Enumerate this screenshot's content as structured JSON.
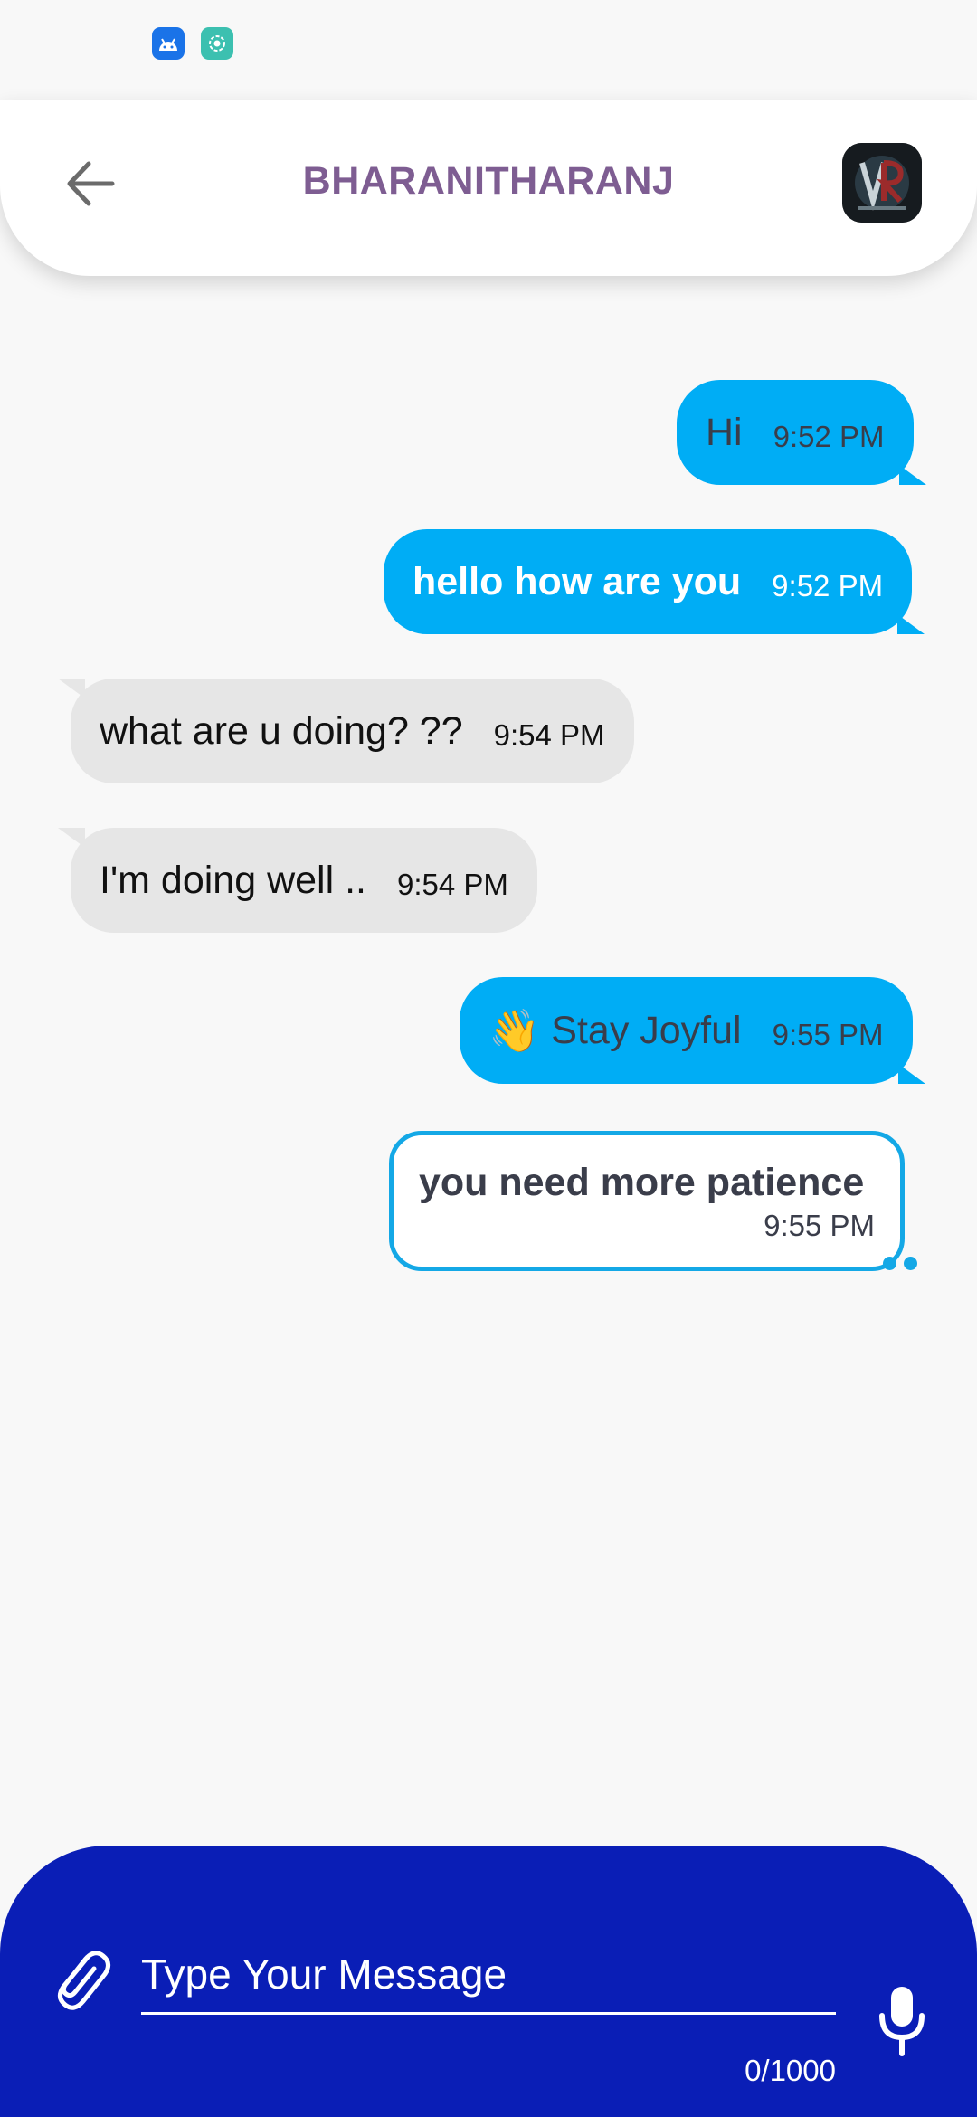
{
  "status_bar": {
    "icons": [
      "android-icon",
      "screen-record-icon"
    ]
  },
  "header": {
    "title": "BHARANITHARANJ",
    "back_icon": "arrow-left-icon",
    "avatar_icon": "profile-avatar"
  },
  "messages": [
    {
      "direction": "sent",
      "text": "Hi",
      "time": "9:52 PM"
    },
    {
      "direction": "sent",
      "text": "hello how are you",
      "time": "9:52 PM"
    },
    {
      "direction": "received",
      "text": "what are u doing? ??",
      "time": "9:54 PM"
    },
    {
      "direction": "received",
      "text": "I'm doing well ..",
      "time": "9:54 PM"
    },
    {
      "direction": "sent",
      "emoji": "👋",
      "text": "Stay Joyful",
      "time": "9:55 PM"
    },
    {
      "direction": "sent",
      "status": "pending",
      "text": "you need more patience",
      "time": "9:55 PM"
    }
  ],
  "composer": {
    "placeholder": "Type Your Message",
    "value": "",
    "counter": "0/1000",
    "attach_icon": "paperclip-icon",
    "mic_icon": "microphone-icon"
  },
  "colors": {
    "sent_bubble": "#00adf5",
    "received_bubble": "#e6e6e6",
    "title": "#7e5d92",
    "composer_bg": "#0a1eb6",
    "outline_bubble_border": "#14a8e6"
  }
}
